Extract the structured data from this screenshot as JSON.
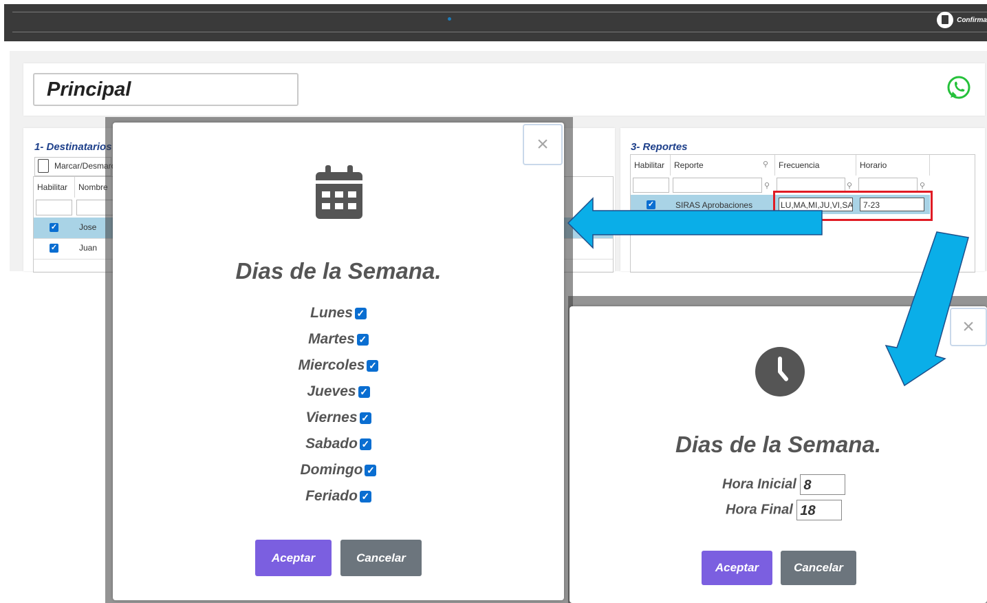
{
  "topbar": {
    "confirm_label": "Confirma"
  },
  "page": {
    "title": "Principal"
  },
  "panel1": {
    "title": "1- Destinatarios",
    "toolbar_label": "Marcar/Desmarcar",
    "headers": [
      "Habilitar",
      "Nombre"
    ],
    "rows": [
      {
        "enabled": true,
        "name": "Jose"
      },
      {
        "enabled": true,
        "name": "Juan"
      }
    ]
  },
  "panel3": {
    "title": "3- Reportes",
    "headers": [
      "Habilitar",
      "Reporte",
      "Frecuencia",
      "Horario"
    ],
    "row": {
      "enabled": true,
      "report": "SIRAS Aprobaciones",
      "frequency": "LU,MA,MI,JU,VI,SA",
      "schedule": "7-23"
    }
  },
  "modal_days": {
    "title": "Dias de la Semana.",
    "days": [
      {
        "label": "Lunes",
        "checked": true
      },
      {
        "label": "Martes",
        "checked": true
      },
      {
        "label": "Miercoles",
        "checked": true
      },
      {
        "label": "Jueves",
        "checked": true
      },
      {
        "label": "Viernes",
        "checked": true
      },
      {
        "label": "Sabado",
        "checked": true
      },
      {
        "label": "Domingo",
        "checked": true
      },
      {
        "label": "Feriado",
        "checked": true
      }
    ],
    "accept_label": "Aceptar",
    "cancel_label": "Cancelar",
    "close_label": "×"
  },
  "modal_hours": {
    "title": "Dias de la Semana.",
    "start_label": "Hora Inicial",
    "start_value": "8",
    "end_label": "Hora Final",
    "end_value": "18",
    "accept_label": "Aceptar",
    "cancel_label": "Cancelar",
    "close_label": "×"
  },
  "colors": {
    "accept": "#7b5fe0",
    "cancel": "#6c757d",
    "arrow": "#0aaee8",
    "highlight": "#e01b24",
    "checkbox": "#0a6ed1"
  }
}
